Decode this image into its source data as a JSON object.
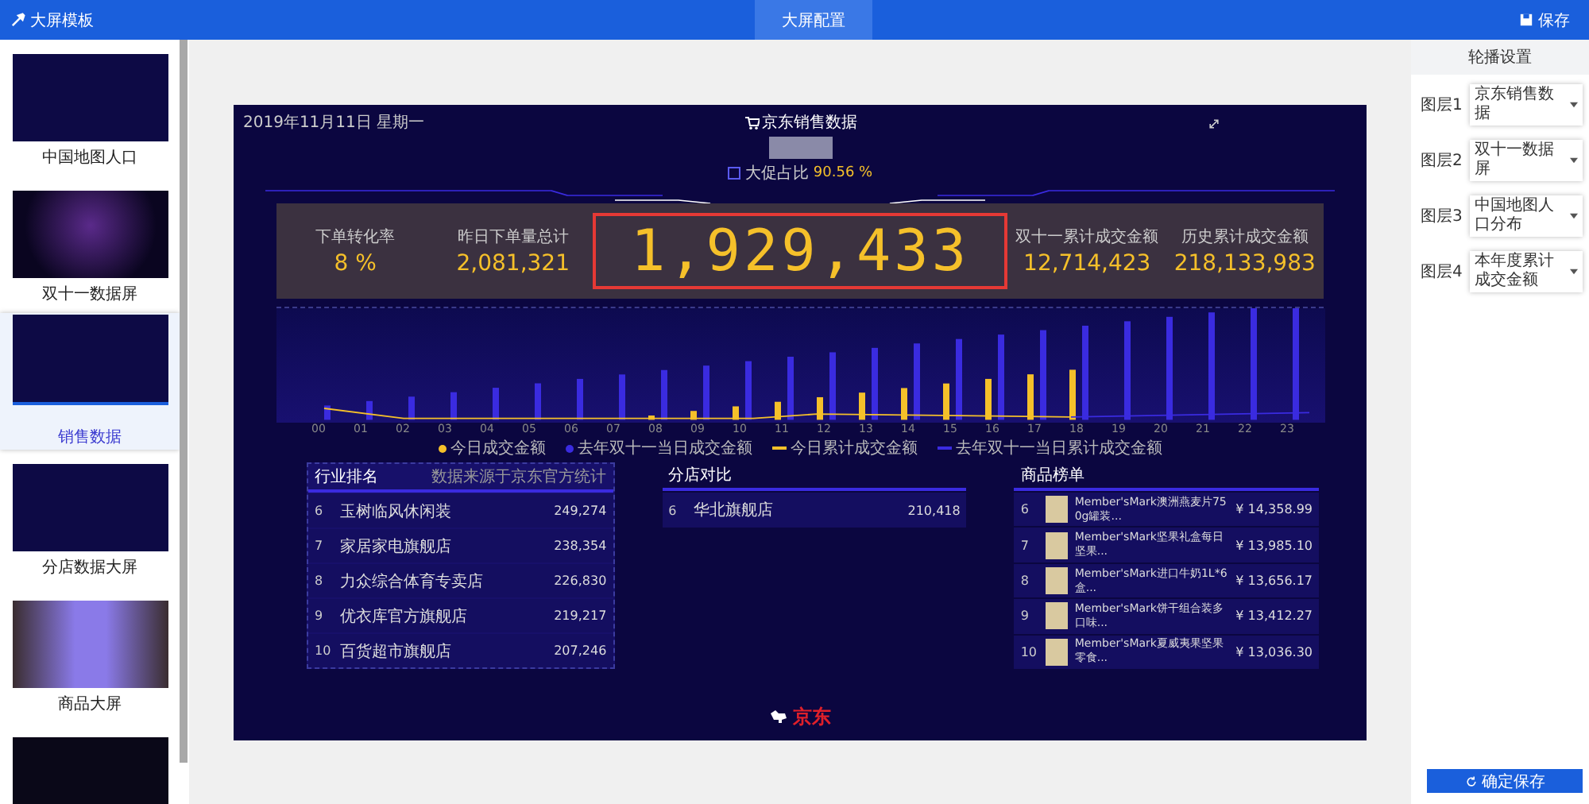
{
  "header": {
    "title": "大屏模板",
    "tabs": [
      {
        "label": "大屏配置",
        "selected": true
      }
    ],
    "save": "保存"
  },
  "sidebar": {
    "items": [
      {
        "label": "中国地图人口",
        "selected": false,
        "kind": "map"
      },
      {
        "label": "双十一数据屏",
        "selected": false,
        "kind": "glow"
      },
      {
        "label": "销售数据",
        "selected": true,
        "kind": "bars"
      },
      {
        "label": "分店数据大屏",
        "selected": false,
        "kind": "table"
      },
      {
        "label": "商品大屏",
        "selected": false,
        "kind": "photo"
      },
      {
        "kind": "clock",
        "selected": false
      }
    ]
  },
  "dashboard": {
    "date": "2019年11月11日 星期一",
    "title": "京东销售数据",
    "ratio_label": "大促占比",
    "ratio_value": "90.56 %",
    "stats": [
      {
        "label": "下单转化率",
        "value": "8 %",
        "kind": "small"
      },
      {
        "label": "昨日下单量总计",
        "value": "2,081,321",
        "kind": "small"
      },
      {
        "value": "1,929,433",
        "kind": "big"
      },
      {
        "label": "双十一累计成交金额",
        "value": "12,714,423",
        "kind": "small"
      },
      {
        "label": "历史累计成交金额",
        "value": "218,133,983",
        "kind": "small"
      }
    ],
    "chart": {
      "x_labels": [
        "00",
        "01",
        "02",
        "03",
        "04",
        "05",
        "06",
        "07",
        "08",
        "09",
        "10",
        "11",
        "12",
        "13",
        "14",
        "15",
        "16",
        "17",
        "18",
        "19",
        "20",
        "21",
        "22",
        "23"
      ],
      "legend": [
        {
          "label": "今日成交金额",
          "color": "#f5c02a",
          "kind": "dot"
        },
        {
          "label": "去年双十一当日成交金额",
          "color": "#3a2be0",
          "kind": "dot"
        },
        {
          "label": "今日累计成交金额",
          "color": "#f5c02a",
          "kind": "line"
        },
        {
          "label": "去年双十一当日累计成交金额",
          "color": "#3a2be0",
          "kind": "line"
        }
      ]
    },
    "industry": {
      "title": "行业排名",
      "note": "数据来源于京东官方统计",
      "rows": [
        {
          "rank": "6",
          "name": "玉树临风休闲装",
          "value": "249,274"
        },
        {
          "rank": "7",
          "name": "家居家电旗舰店",
          "value": "238,354"
        },
        {
          "rank": "8",
          "name": "力众综合体育专卖店",
          "value": "226,830"
        },
        {
          "rank": "9",
          "name": "优衣库官方旗舰店",
          "value": "219,217"
        },
        {
          "rank": "10",
          "name": "百货超市旗舰店",
          "value": "207,246"
        }
      ]
    },
    "branches": {
      "title": "分店对比",
      "rows": [
        {
          "rank": "6",
          "name": "华北旗舰店",
          "value": "210,418"
        }
      ]
    },
    "products": {
      "title": "商品榜单",
      "rows": [
        {
          "rank": "6",
          "name": "Member'sMark澳洲燕麦片750g罐装...",
          "price": "¥ 14,358.99"
        },
        {
          "rank": "7",
          "name": "Member'sMark坚果礼盒每日坚果...",
          "price": "¥ 13,985.10"
        },
        {
          "rank": "8",
          "name": "Member'sMark进口牛奶1L*6盒...",
          "price": "¥ 13,656.17"
        },
        {
          "rank": "9",
          "name": "Member'sMark饼干组合装多口味...",
          "price": "¥ 13,412.27"
        },
        {
          "rank": "10",
          "name": "Member'sMark夏威夷果坚果零食...",
          "price": "¥ 13,036.30"
        }
      ]
    },
    "brand": "京东"
  },
  "panel": {
    "title": "轮播设置",
    "layers": [
      {
        "label": "图层1",
        "value": "京东销售数据"
      },
      {
        "label": "图层2",
        "value": "双十一数据屏"
      },
      {
        "label": "图层3",
        "value": "中国地图人口分布"
      },
      {
        "label": "图层4",
        "value": "本年度累计成交金额"
      }
    ],
    "confirm": "确定保存"
  }
}
